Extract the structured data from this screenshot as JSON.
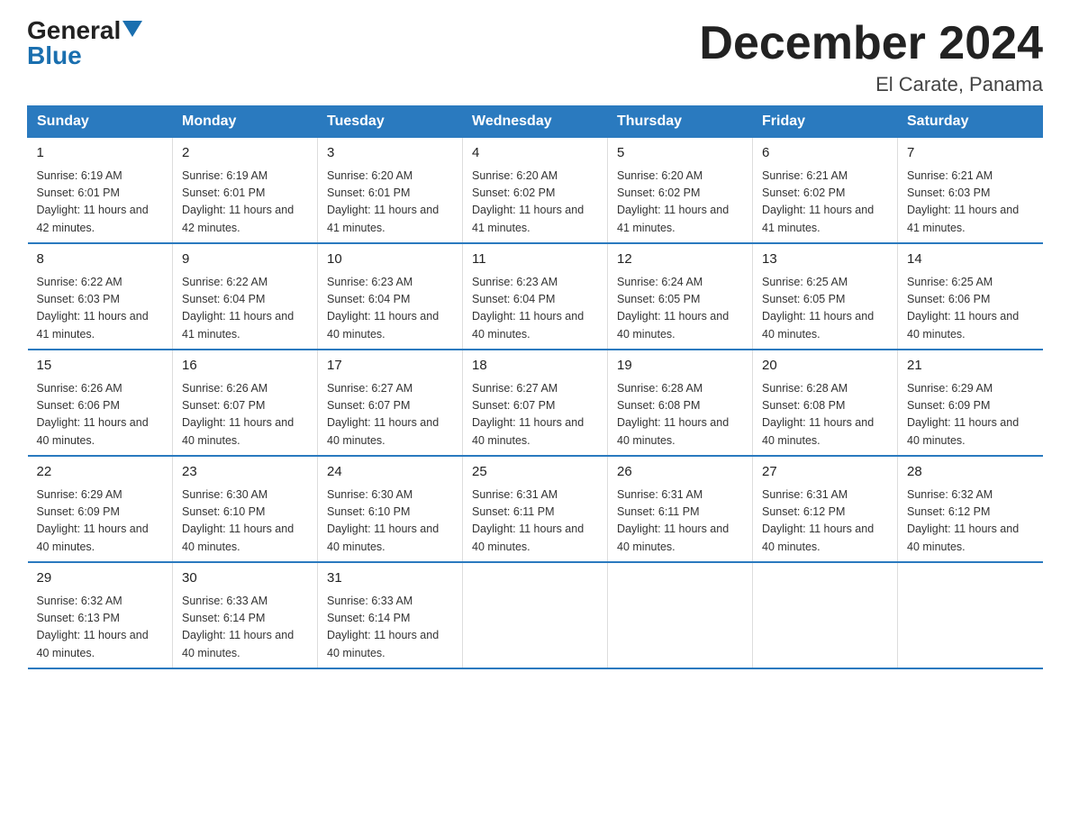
{
  "header": {
    "logo_general": "General",
    "logo_blue": "Blue",
    "month_title": "December 2024",
    "location": "El Carate, Panama"
  },
  "days_of_week": [
    "Sunday",
    "Monday",
    "Tuesday",
    "Wednesday",
    "Thursday",
    "Friday",
    "Saturday"
  ],
  "weeks": [
    [
      {
        "day": "1",
        "sunrise": "6:19 AM",
        "sunset": "6:01 PM",
        "daylight": "11 hours and 42 minutes."
      },
      {
        "day": "2",
        "sunrise": "6:19 AM",
        "sunset": "6:01 PM",
        "daylight": "11 hours and 42 minutes."
      },
      {
        "day": "3",
        "sunrise": "6:20 AM",
        "sunset": "6:01 PM",
        "daylight": "11 hours and 41 minutes."
      },
      {
        "day": "4",
        "sunrise": "6:20 AM",
        "sunset": "6:02 PM",
        "daylight": "11 hours and 41 minutes."
      },
      {
        "day": "5",
        "sunrise": "6:20 AM",
        "sunset": "6:02 PM",
        "daylight": "11 hours and 41 minutes."
      },
      {
        "day": "6",
        "sunrise": "6:21 AM",
        "sunset": "6:02 PM",
        "daylight": "11 hours and 41 minutes."
      },
      {
        "day": "7",
        "sunrise": "6:21 AM",
        "sunset": "6:03 PM",
        "daylight": "11 hours and 41 minutes."
      }
    ],
    [
      {
        "day": "8",
        "sunrise": "6:22 AM",
        "sunset": "6:03 PM",
        "daylight": "11 hours and 41 minutes."
      },
      {
        "day": "9",
        "sunrise": "6:22 AM",
        "sunset": "6:04 PM",
        "daylight": "11 hours and 41 minutes."
      },
      {
        "day": "10",
        "sunrise": "6:23 AM",
        "sunset": "6:04 PM",
        "daylight": "11 hours and 40 minutes."
      },
      {
        "day": "11",
        "sunrise": "6:23 AM",
        "sunset": "6:04 PM",
        "daylight": "11 hours and 40 minutes."
      },
      {
        "day": "12",
        "sunrise": "6:24 AM",
        "sunset": "6:05 PM",
        "daylight": "11 hours and 40 minutes."
      },
      {
        "day": "13",
        "sunrise": "6:25 AM",
        "sunset": "6:05 PM",
        "daylight": "11 hours and 40 minutes."
      },
      {
        "day": "14",
        "sunrise": "6:25 AM",
        "sunset": "6:06 PM",
        "daylight": "11 hours and 40 minutes."
      }
    ],
    [
      {
        "day": "15",
        "sunrise": "6:26 AM",
        "sunset": "6:06 PM",
        "daylight": "11 hours and 40 minutes."
      },
      {
        "day": "16",
        "sunrise": "6:26 AM",
        "sunset": "6:07 PM",
        "daylight": "11 hours and 40 minutes."
      },
      {
        "day": "17",
        "sunrise": "6:27 AM",
        "sunset": "6:07 PM",
        "daylight": "11 hours and 40 minutes."
      },
      {
        "day": "18",
        "sunrise": "6:27 AM",
        "sunset": "6:07 PM",
        "daylight": "11 hours and 40 minutes."
      },
      {
        "day": "19",
        "sunrise": "6:28 AM",
        "sunset": "6:08 PM",
        "daylight": "11 hours and 40 minutes."
      },
      {
        "day": "20",
        "sunrise": "6:28 AM",
        "sunset": "6:08 PM",
        "daylight": "11 hours and 40 minutes."
      },
      {
        "day": "21",
        "sunrise": "6:29 AM",
        "sunset": "6:09 PM",
        "daylight": "11 hours and 40 minutes."
      }
    ],
    [
      {
        "day": "22",
        "sunrise": "6:29 AM",
        "sunset": "6:09 PM",
        "daylight": "11 hours and 40 minutes."
      },
      {
        "day": "23",
        "sunrise": "6:30 AM",
        "sunset": "6:10 PM",
        "daylight": "11 hours and 40 minutes."
      },
      {
        "day": "24",
        "sunrise": "6:30 AM",
        "sunset": "6:10 PM",
        "daylight": "11 hours and 40 minutes."
      },
      {
        "day": "25",
        "sunrise": "6:31 AM",
        "sunset": "6:11 PM",
        "daylight": "11 hours and 40 minutes."
      },
      {
        "day": "26",
        "sunrise": "6:31 AM",
        "sunset": "6:11 PM",
        "daylight": "11 hours and 40 minutes."
      },
      {
        "day": "27",
        "sunrise": "6:31 AM",
        "sunset": "6:12 PM",
        "daylight": "11 hours and 40 minutes."
      },
      {
        "day": "28",
        "sunrise": "6:32 AM",
        "sunset": "6:12 PM",
        "daylight": "11 hours and 40 minutes."
      }
    ],
    [
      {
        "day": "29",
        "sunrise": "6:32 AM",
        "sunset": "6:13 PM",
        "daylight": "11 hours and 40 minutes."
      },
      {
        "day": "30",
        "sunrise": "6:33 AM",
        "sunset": "6:14 PM",
        "daylight": "11 hours and 40 minutes."
      },
      {
        "day": "31",
        "sunrise": "6:33 AM",
        "sunset": "6:14 PM",
        "daylight": "11 hours and 40 minutes."
      },
      null,
      null,
      null,
      null
    ]
  ]
}
